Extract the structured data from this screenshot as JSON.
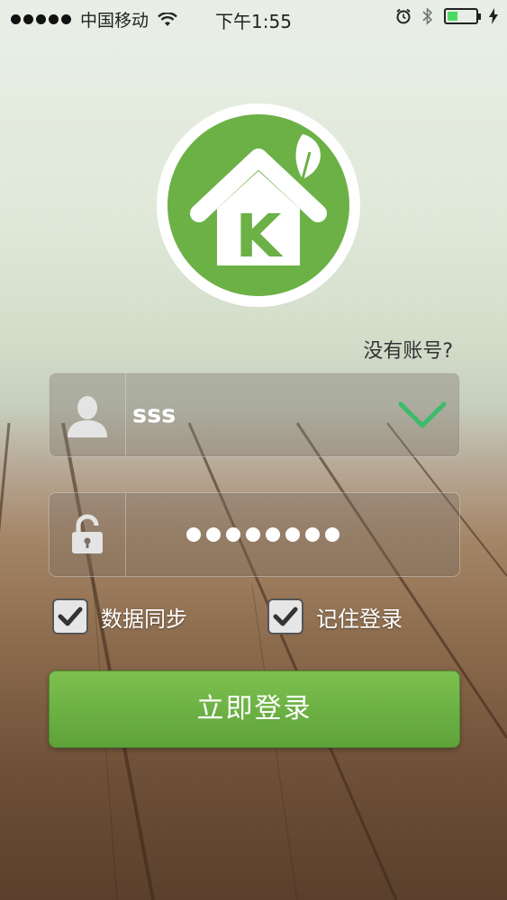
{
  "status_bar": {
    "carrier": "中国移动",
    "time": "下午1:55",
    "battery_level": 0.35
  },
  "app": {
    "logo_letter": "K",
    "no_account_link": "没有账号?"
  },
  "form": {
    "username": {
      "value": "sss",
      "icon": "user-icon",
      "valid_icon": "checkmark-chevron-icon"
    },
    "password": {
      "masked_length": 8,
      "icon": "lock-icon"
    },
    "options": [
      {
        "label": "数据同步",
        "checked": true
      },
      {
        "label": "记住登录",
        "checked": true
      }
    ],
    "login_button": "立即登录"
  },
  "colors": {
    "brand_green": "#6cb146",
    "button_green": "#66aa40",
    "check_green": "#3dbb6a"
  }
}
